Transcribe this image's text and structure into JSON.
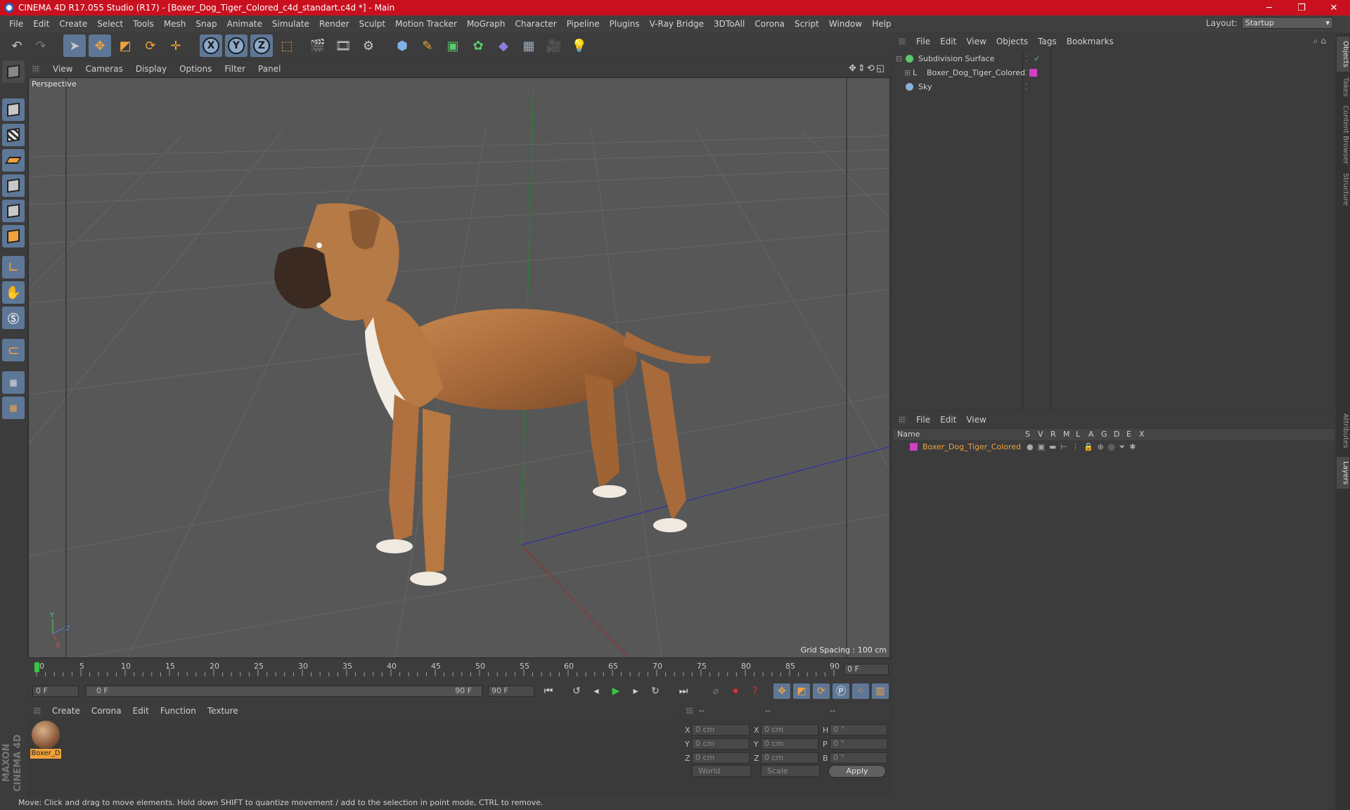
{
  "window": {
    "title": "CINEMA 4D R17.055 Studio (R17) - [Boxer_Dog_Tiger_Colored_c4d_standart.c4d *] - Main",
    "controls": [
      "─",
      "❐",
      "✕"
    ]
  },
  "menubar": {
    "items": [
      "File",
      "Edit",
      "Create",
      "Select",
      "Tools",
      "Mesh",
      "Snap",
      "Animate",
      "Simulate",
      "Render",
      "Sculpt",
      "Motion Tracker",
      "MoGraph",
      "Character",
      "Pipeline",
      "Plugins",
      "V-Ray Bridge",
      "3DToAll",
      "Corona",
      "Script",
      "Window",
      "Help"
    ],
    "layout_label": "Layout:",
    "layout_value": "Startup"
  },
  "viewport": {
    "menu": [
      "View",
      "Cameras",
      "Display",
      "Options",
      "Filter",
      "Panel"
    ],
    "label": "Perspective",
    "grid_spacing": "Grid Spacing : 100 cm",
    "nav_icons": "✥⇕⟲◱"
  },
  "timeline": {
    "ticks": [
      "0",
      "5",
      "10",
      "15",
      "20",
      "25",
      "30",
      "35",
      "40",
      "45",
      "50",
      "55",
      "60",
      "65",
      "70",
      "75",
      "80",
      "85",
      "90"
    ],
    "current_frame": "0 F",
    "start_field": "0 F",
    "range_start": "0 F",
    "range_end": "90 F",
    "end_field": "90 F"
  },
  "materials": {
    "menu": [
      "Create",
      "Corona",
      "Edit",
      "Function",
      "Texture"
    ],
    "items": [
      {
        "label": "Boxer_D"
      }
    ]
  },
  "coordinates": {
    "headers": [
      "--",
      "--",
      "--"
    ],
    "rows": [
      {
        "a": "X",
        "av": "0 cm",
        "b": "X",
        "bv": "0 cm",
        "c": "H",
        "cv": "0 °"
      },
      {
        "a": "Y",
        "av": "0 cm",
        "b": "Y",
        "bv": "0 cm",
        "c": "P",
        "cv": "0 °"
      },
      {
        "a": "Z",
        "av": "0 cm",
        "b": "Z",
        "bv": "0 cm",
        "c": "B",
        "cv": "0 °"
      }
    ],
    "mode": "World",
    "scale": "Scale",
    "apply": "Apply"
  },
  "status": "Move: Click and drag to move elements. Hold down SHIFT to quantize movement / add to the selection in point mode, CTRL to remove.",
  "objects": {
    "menu": [
      "File",
      "Edit",
      "View",
      "Objects",
      "Tags",
      "Bookmarks"
    ],
    "rows": [
      {
        "name": "Subdivision Surface",
        "color": "#5bc86b"
      },
      {
        "name": "Boxer_Dog_Tiger_Colored",
        "color": "#c8c8c8"
      },
      {
        "name": "Sky",
        "color": "#8ab0d8"
      }
    ]
  },
  "layers": {
    "menu": [
      "File",
      "Edit",
      "View"
    ],
    "columns": [
      "Name",
      "S",
      "V",
      "R",
      "M",
      "L",
      "A",
      "G",
      "D",
      "E",
      "X"
    ],
    "rows": [
      {
        "name": "Boxer_Dog_Tiger_Colored"
      }
    ]
  },
  "right_tabs": [
    "Objects",
    "Takes",
    "Content Browser",
    "Structure",
    "Attributes",
    "Layers"
  ],
  "brand": "MAXON CINEMA 4D",
  "colors": {
    "accent": "#5e7797",
    "title_bar": "#c8101f",
    "selection": "#f0a23c"
  }
}
